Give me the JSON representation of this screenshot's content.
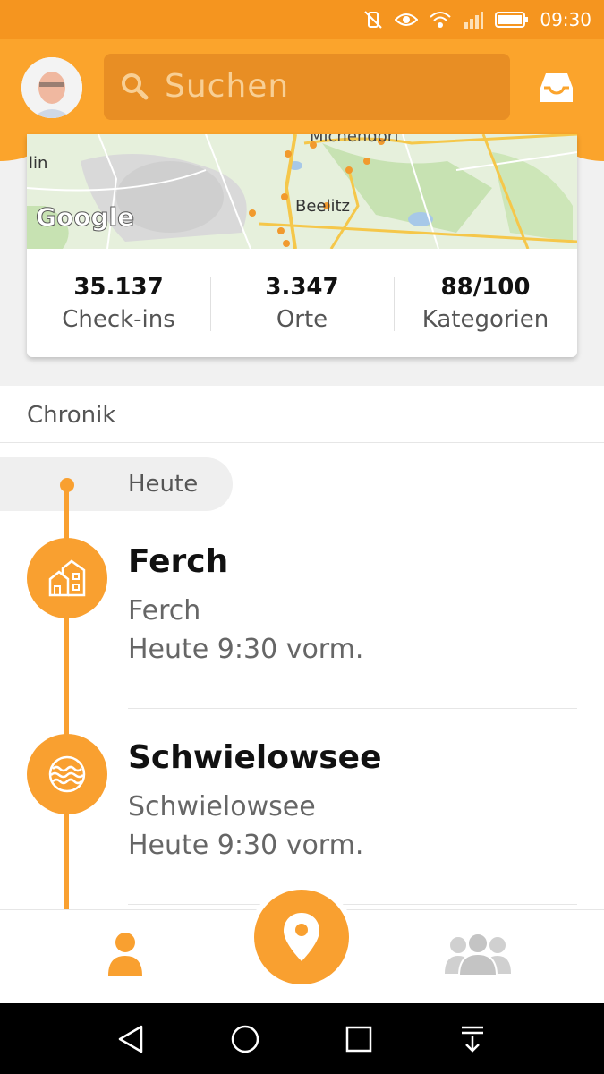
{
  "status_bar": {
    "time": "09:30"
  },
  "search": {
    "placeholder": "Suchen"
  },
  "map": {
    "labels": {
      "town_main": "Beelitz",
      "town_top": "Michendorf",
      "town_left": "lin"
    },
    "brand": "Google"
  },
  "stats": [
    {
      "value": "35.137",
      "label": "Check-ins"
    },
    {
      "value": "3.347",
      "label": "Orte"
    },
    {
      "value": "88/100",
      "label": "Kategorien"
    }
  ],
  "chronik": {
    "title": "Chronik",
    "day_label": "Heute",
    "items": [
      {
        "title": "Ferch",
        "place": "Ferch",
        "time": "Heute 9:30 vorm.",
        "icon": "town-icon"
      },
      {
        "title": "Schwielowsee",
        "place": "Schwielowsee",
        "time": "Heute 9:30 vorm.",
        "icon": "lake-icon"
      }
    ]
  },
  "colors": {
    "accent": "#f9a030",
    "header": "#fba42c",
    "status_bar": "#f5951f"
  }
}
